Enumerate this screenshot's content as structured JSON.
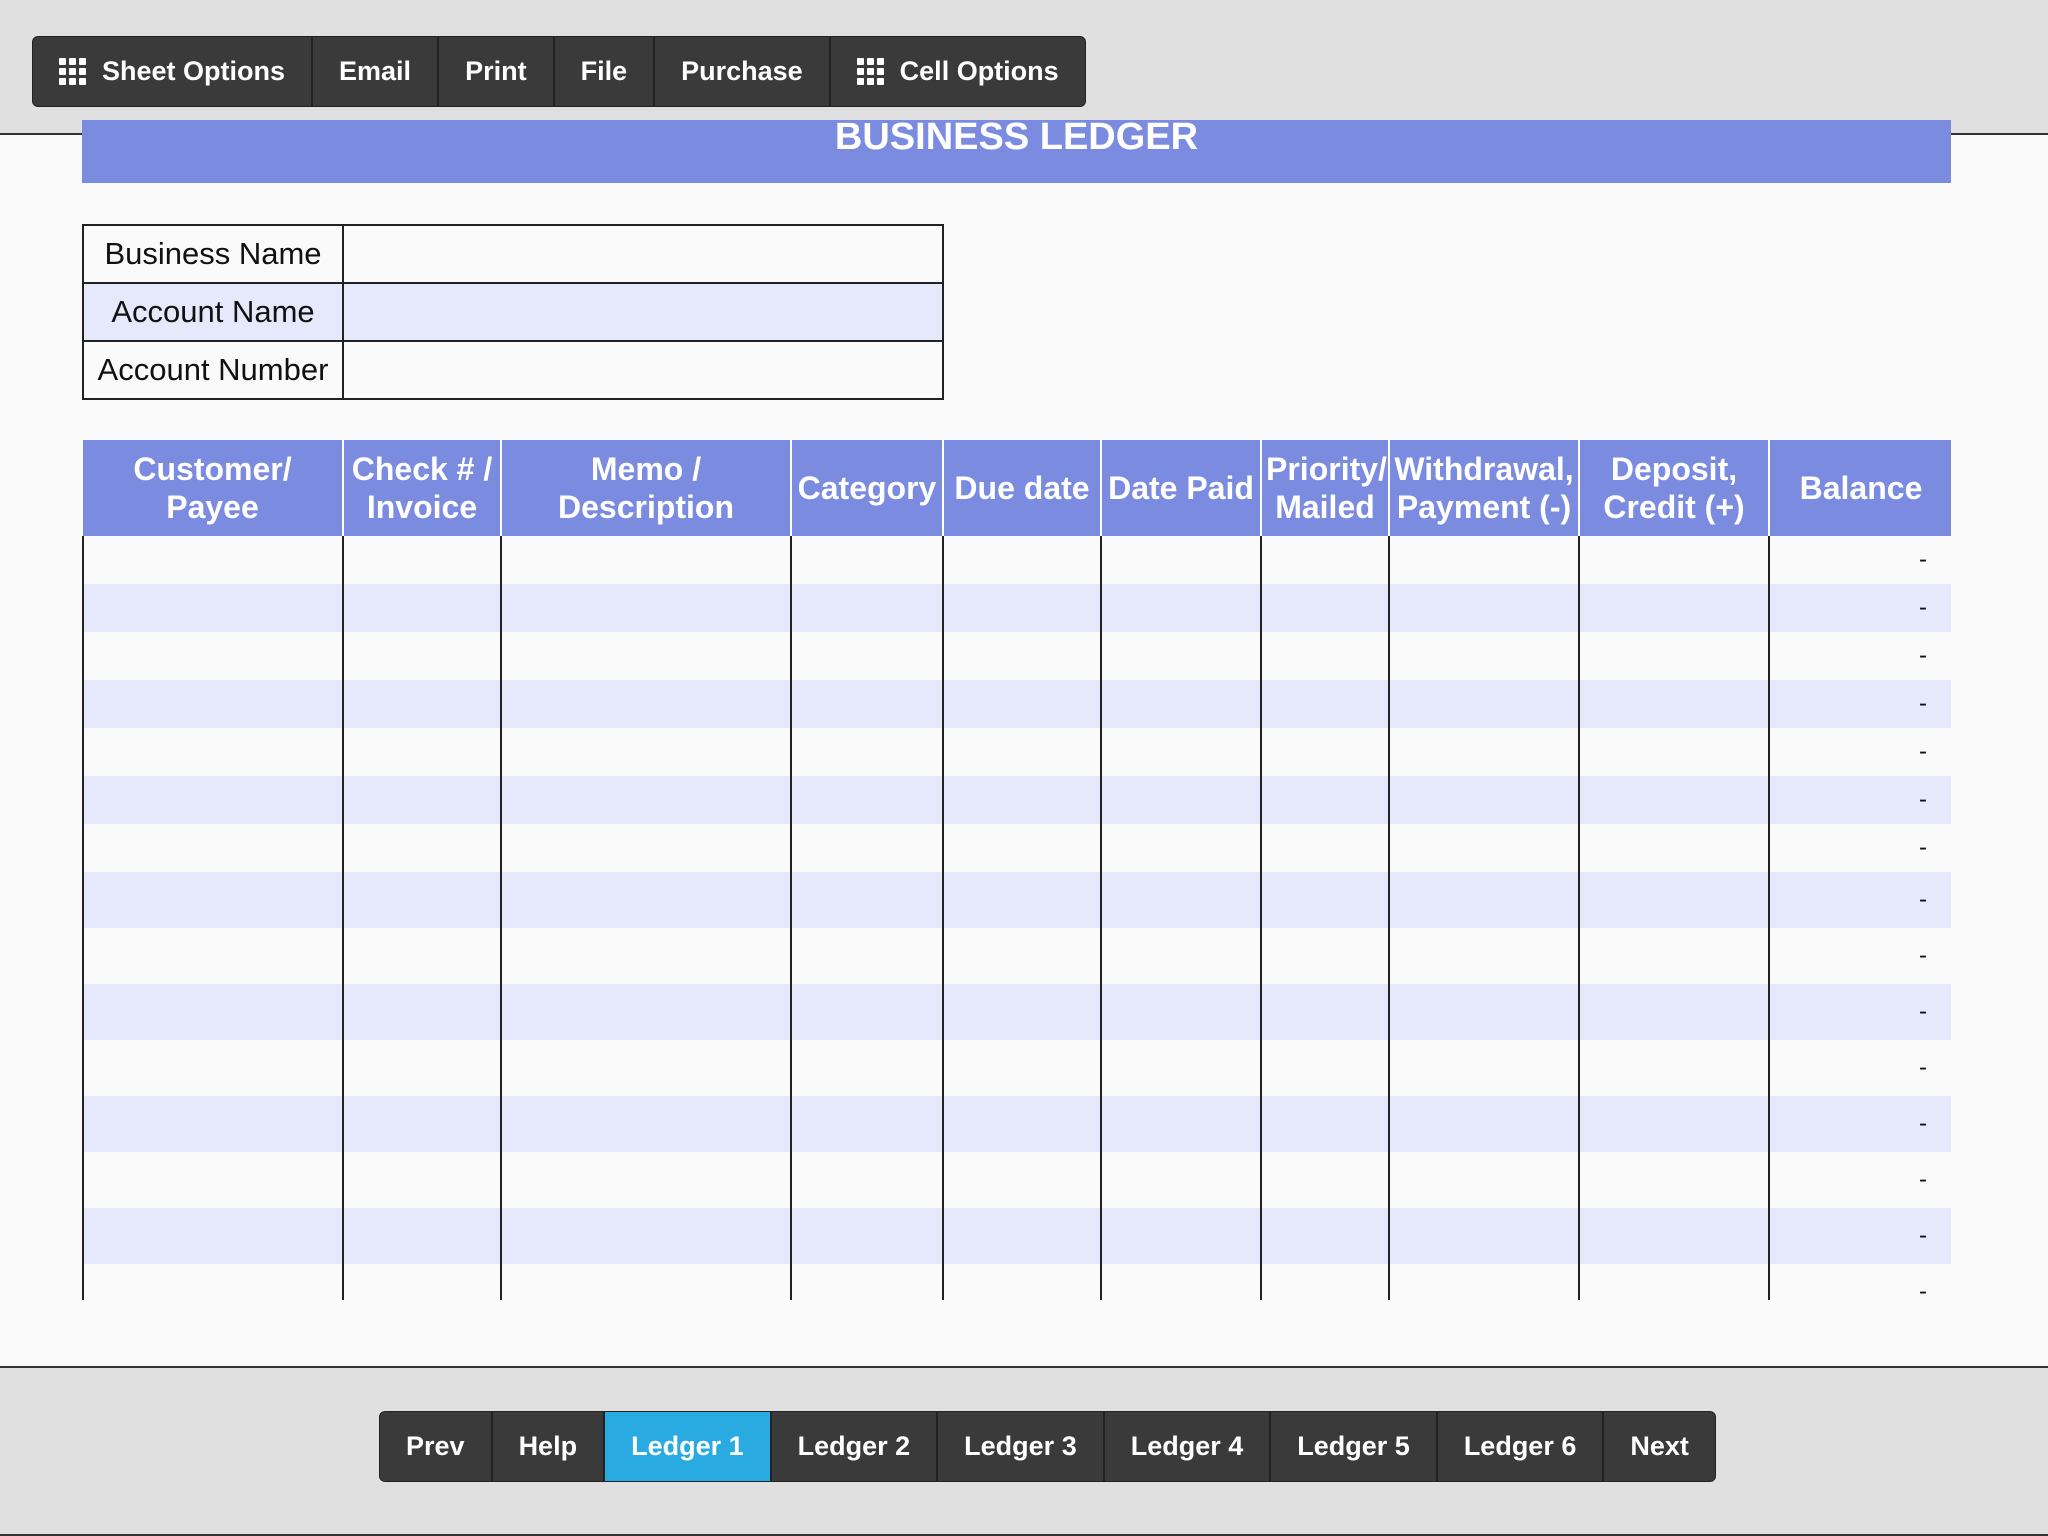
{
  "toolbar": {
    "sheet_options": "Sheet Options",
    "email": "Email",
    "print": "Print",
    "file": "File",
    "purchase": "Purchase",
    "cell_options": "Cell Options"
  },
  "sheet": {
    "title": "BUSINESS LEDGER"
  },
  "info": {
    "business_name_label": "Business Name",
    "business_name_value": "",
    "account_name_label": "Account Name",
    "account_name_value": "",
    "account_number_label": "Account Number",
    "account_number_value": ""
  },
  "ledger": {
    "columns": {
      "payee": [
        "Customer/",
        "Payee"
      ],
      "check": [
        "Check # /",
        "Invoice"
      ],
      "memo": [
        "Memo /",
        "Description"
      ],
      "category": [
        "Category"
      ],
      "due_date": [
        "Due date"
      ],
      "date_paid": [
        "Date Paid"
      ],
      "priority": [
        "Priority/",
        "Mailed"
      ],
      "withdrawal": [
        "Withdrawal,",
        "Payment (-)"
      ],
      "deposit": [
        "Deposit,",
        "Credit (+)"
      ],
      "balance": [
        "Balance"
      ]
    },
    "balances": [
      "-",
      "-",
      "-",
      "-",
      "-",
      "-",
      "-",
      "-",
      "-",
      "-",
      "-",
      "-",
      "-",
      "-",
      "-"
    ]
  },
  "pager": {
    "prev": "Prev",
    "help": "Help",
    "ledger1": "Ledger 1",
    "ledger2": "Ledger 2",
    "ledger3": "Ledger 3",
    "ledger4": "Ledger 4",
    "ledger5": "Ledger 5",
    "ledger6": "Ledger 6",
    "next": "Next"
  },
  "colors": {
    "header": "#7b8be0",
    "alt_row": "#e6e8fb",
    "active_tab": "#29abe2",
    "toolbar": "#333333"
  }
}
